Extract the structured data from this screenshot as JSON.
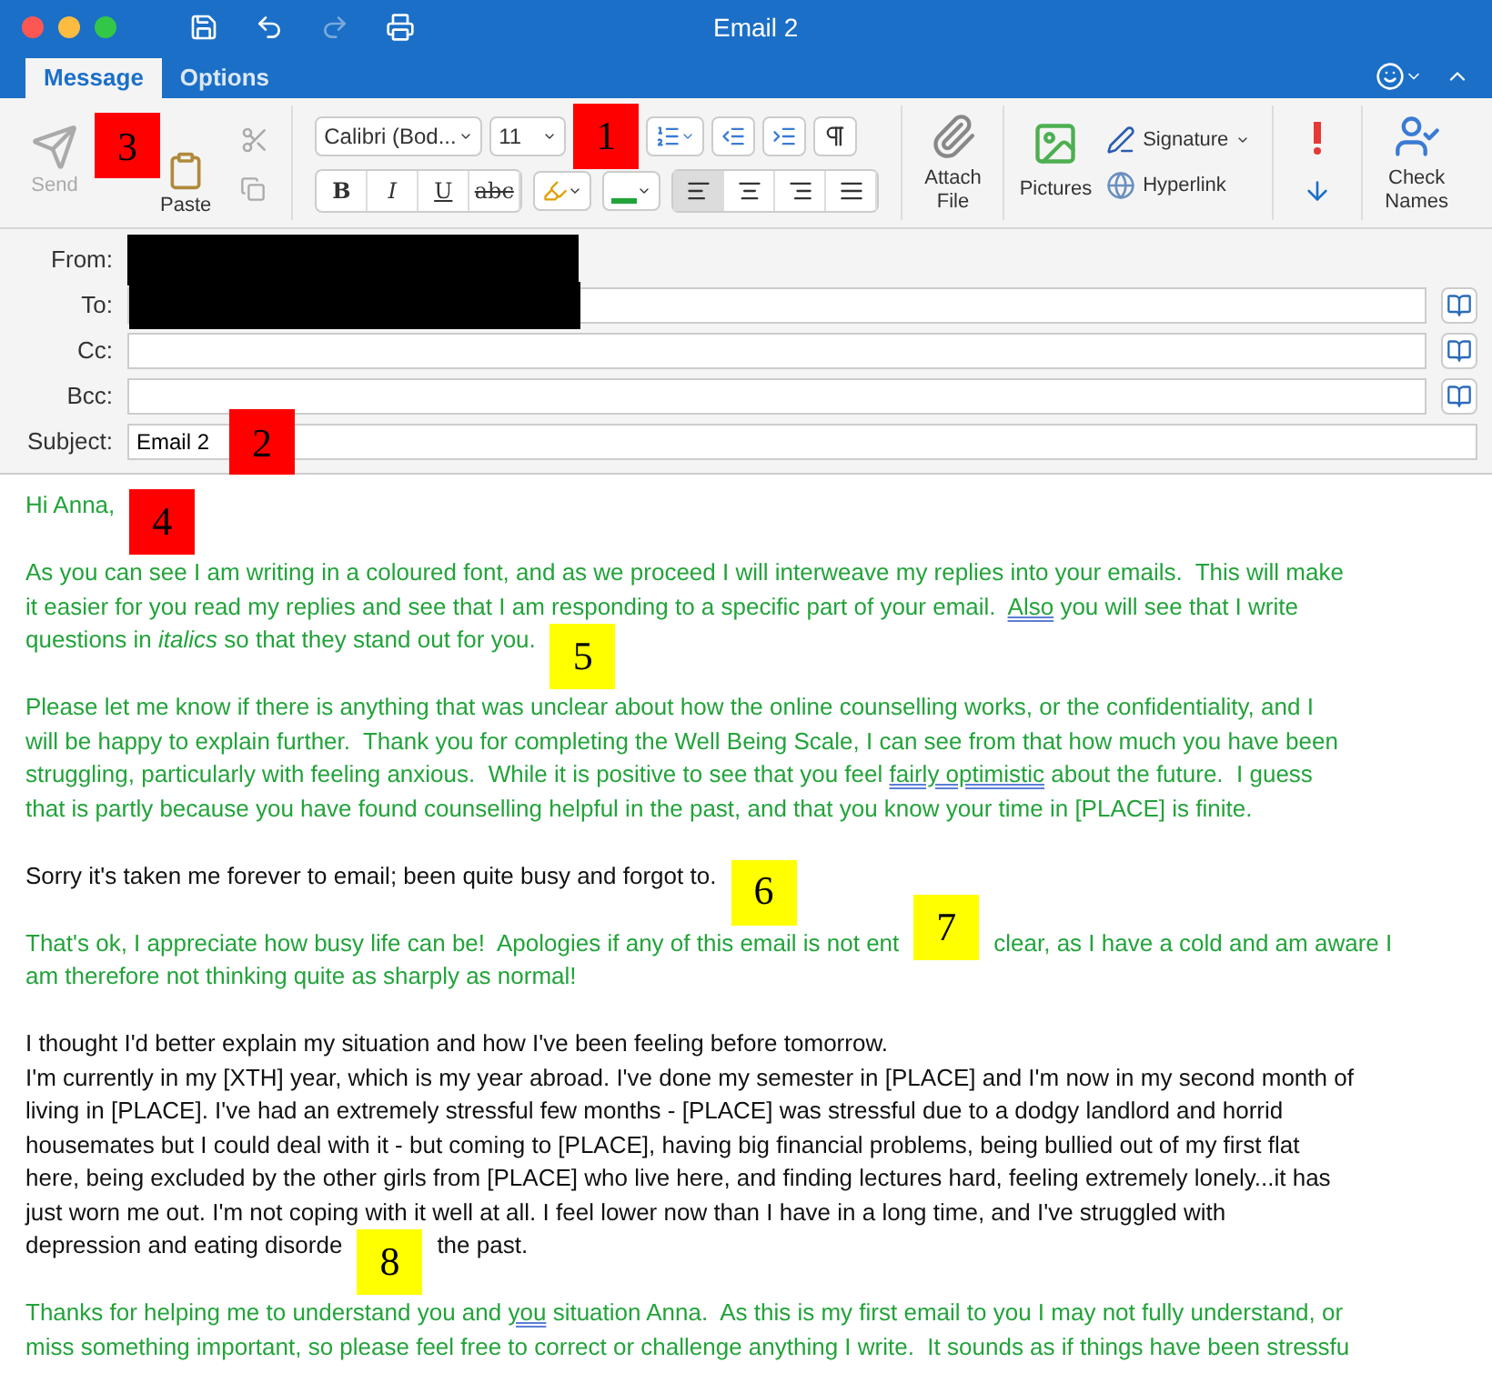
{
  "window": {
    "title": "Email 2"
  },
  "tabs": [
    {
      "label": "Message",
      "selected": true
    },
    {
      "label": "Options",
      "selected": false
    }
  ],
  "ribbon": {
    "send": {
      "label": "Send",
      "disabled": true
    },
    "paste": {
      "label": "Paste"
    },
    "font": "Calibri (Bod...",
    "size": "11",
    "format_buttons": [
      "B",
      "I",
      "U",
      "abc"
    ],
    "alignment": [
      {
        "selected": true
      },
      {
        "selected": false
      },
      {
        "selected": false
      },
      {
        "selected": false
      }
    ],
    "attach": [
      "Attach",
      "File"
    ],
    "pictures": "Pictures",
    "signature": "Signature",
    "hyperlink": "Hyperlink",
    "check_names": [
      "Check",
      "Names"
    ],
    "markers": [
      {
        "label": "3",
        "color": "#ff0000"
      },
      {
        "label": "1",
        "color": "#ff0000"
      }
    ]
  },
  "header": [
    {
      "label": "From:",
      "kind": "redacted"
    },
    {
      "label": "To:",
      "kind": "redacted-field"
    },
    {
      "label": "Cc:",
      "kind": "field"
    },
    {
      "label": "Bcc:",
      "kind": "field"
    },
    {
      "label": "Subject:",
      "kind": "subject",
      "value": "Email 2",
      "marker": {
        "label": "2",
        "color": "#ff0000"
      }
    }
  ],
  "body": [
    {
      "kind": "reply",
      "lines": [
        [
          {
            "kind": "text",
            "text": "Hi Anna,"
          },
          {
            "kind": "marker",
            "label": "4",
            "color": "#ff0000"
          }
        ]
      ]
    },
    {
      "kind": "reply",
      "lines": [
        [
          {
            "kind": "text",
            "text": "As you can see I am writing in a coloured font, and as we proceed I will interweave my replies into your emails.  This will make"
          }
        ],
        [
          {
            "kind": "text",
            "text": "it easier for you read my replies and see that I am responding to a specific part of your email.  "
          },
          {
            "kind": "flagged",
            "text": "Also"
          },
          {
            "kind": "text",
            "text": " you will see that I write"
          }
        ],
        [
          {
            "kind": "text",
            "text": "questions in *italics* so that they stand out for you."
          },
          {
            "kind": "marker",
            "label": "5",
            "color": "#ffff00"
          }
        ]
      ]
    },
    {
      "kind": "reply",
      "lines": [
        [
          {
            "kind": "text",
            "text": "Please let me know if there is anything that was unclear about how the online counselling works, or the confidentiality, and I"
          }
        ],
        [
          {
            "kind": "text",
            "text": "will be happy to explain further.  Thank you for completing the Well Being Scale, I can see from that how much you have been"
          }
        ],
        [
          {
            "kind": "text",
            "text": "struggling, particularly with feeling anxious.  While it is positive to see that you feel "
          },
          {
            "kind": "flagged",
            "text": "fairly optimistic"
          },
          {
            "kind": "text",
            "text": " about the future.  I guess"
          }
        ],
        [
          {
            "kind": "text",
            "text": "that is partly because you have found counselling helpful in the past, and that you know your time in [PLACE] is finite."
          }
        ]
      ]
    },
    {
      "kind": "client",
      "lines": [
        [
          {
            "kind": "text",
            "text": "Sorry it's taken me forever to email; been quite busy and forgot to."
          },
          {
            "kind": "marker",
            "label": "6",
            "color": "#ffff00"
          }
        ]
      ]
    },
    {
      "kind": "reply",
      "lines": [
        [
          {
            "kind": "text",
            "text": "That's ok, I appreciate how busy life can be!  Apologies if any of this email is not ent"
          },
          {
            "kind": "marker",
            "label": "7",
            "color": "#ffff00"
          },
          {
            "kind": "text",
            "text": "clear, as I have a cold and am aware I"
          }
        ],
        [
          {
            "kind": "text",
            "text": "am therefore not thinking quite as sharply as normal!"
          }
        ]
      ]
    },
    {
      "kind": "client",
      "lines": [
        [
          {
            "kind": "text",
            "text": "I thought I'd better explain my situation and how I've been feeling before tomorrow."
          }
        ],
        [
          {
            "kind": "text",
            "text": "I'm currently in my [XTH] year, which is my year abroad. I've done my semester in [PLACE] and I'm now in my second month of"
          }
        ],
        [
          {
            "kind": "text",
            "text": "living in [PLACE]. I've had an extremely stressful few months - [PLACE] was stressful due to a dodgy landlord and horrid"
          }
        ],
        [
          {
            "kind": "text",
            "text": "housemates but I could deal with it - but coming to [PLACE], having big financial problems, being bullied out of my first flat"
          }
        ],
        [
          {
            "kind": "text",
            "text": "here, being excluded by the other girls from [PLACE] who live here, and finding lectures hard, feeling extremely lonely...it has"
          }
        ],
        [
          {
            "kind": "text",
            "text": "just worn me out. I'm not coping with it well at all. I feel lower now than I have in a long time, and I've struggled with"
          }
        ],
        [
          {
            "kind": "text",
            "text": "depression and eating disorde"
          },
          {
            "kind": "marker",
            "label": "8",
            "color": "#ffff00"
          },
          {
            "kind": "text",
            "text": "the past."
          }
        ]
      ]
    },
    {
      "kind": "reply",
      "lines": [
        [
          {
            "kind": "text",
            "text": "Thanks for helping me to understand you and "
          },
          {
            "kind": "flagged",
            "text": "you"
          },
          {
            "kind": "text",
            "text": " situation Anna.  As this is my first email to you I may not fully understand, or"
          }
        ],
        [
          {
            "kind": "text",
            "text": "miss something important, so please feel free to correct or challenge anything I write.  It sounds as if things have been stressfu"
          }
        ]
      ]
    }
  ]
}
